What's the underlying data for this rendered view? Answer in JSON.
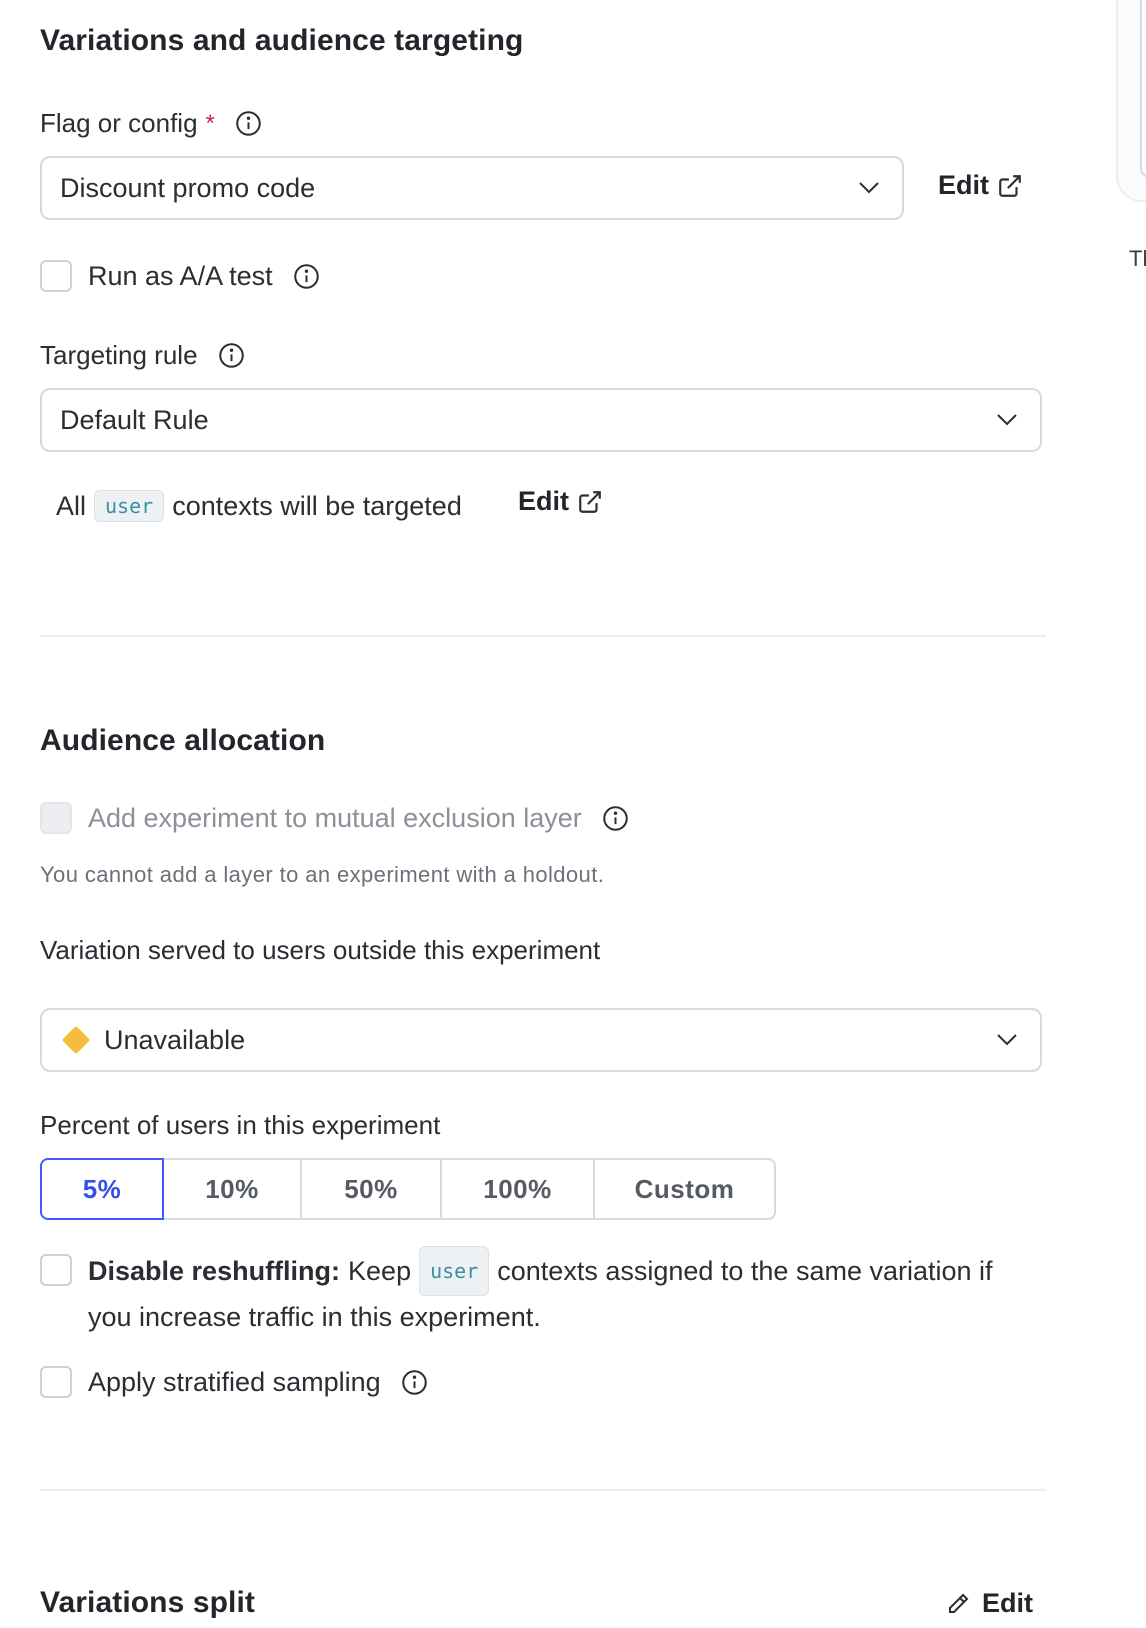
{
  "sections": {
    "targeting": {
      "title": "Variations and audience targeting",
      "flag_label": "Flag or config",
      "required_mark": "*",
      "flag_value": "Discount promo code",
      "flag_edit": "Edit",
      "aa_test_label": "Run as A/A test",
      "rule_label": "Targeting rule",
      "rule_value": "Default Rule",
      "contexts_prefix": "All",
      "contexts_kind": "user",
      "contexts_suffix": "contexts will be targeted",
      "rule_edit": "Edit"
    },
    "allocation": {
      "title": "Audience allocation",
      "layer_label": "Add experiment to mutual exclusion layer",
      "layer_note": "You cannot add a layer to an experiment with a holdout.",
      "outside_label": "Variation served to users outside this experiment",
      "outside_value": "Unavailable",
      "percent_label": "Percent of users in this experiment",
      "percent_options": [
        "5%",
        "10%",
        "50%",
        "100%",
        "Custom"
      ],
      "percent_selected": "5%",
      "reshuffle_bold": "Disable reshuffling:",
      "reshuffle_pre": "Keep",
      "reshuffle_kind": "user",
      "reshuffle_post": "contexts assigned to the same variation if",
      "reshuffle_line2": "you increase traffic in this experiment.",
      "stratified_label": "Apply stratified sampling"
    },
    "split": {
      "title": "Variations split",
      "edit": "Edit"
    }
  },
  "side_panel": {
    "truncated_text": "Th"
  },
  "colors": {
    "accent": "#405bff",
    "required": "#d3204d",
    "unavailable_marker": "#f3bd37",
    "code_text": "#3a8fa6"
  },
  "icons": [
    "info-icon",
    "chevron-down-icon",
    "external-link-icon",
    "diamond-icon",
    "pencil-icon"
  ]
}
